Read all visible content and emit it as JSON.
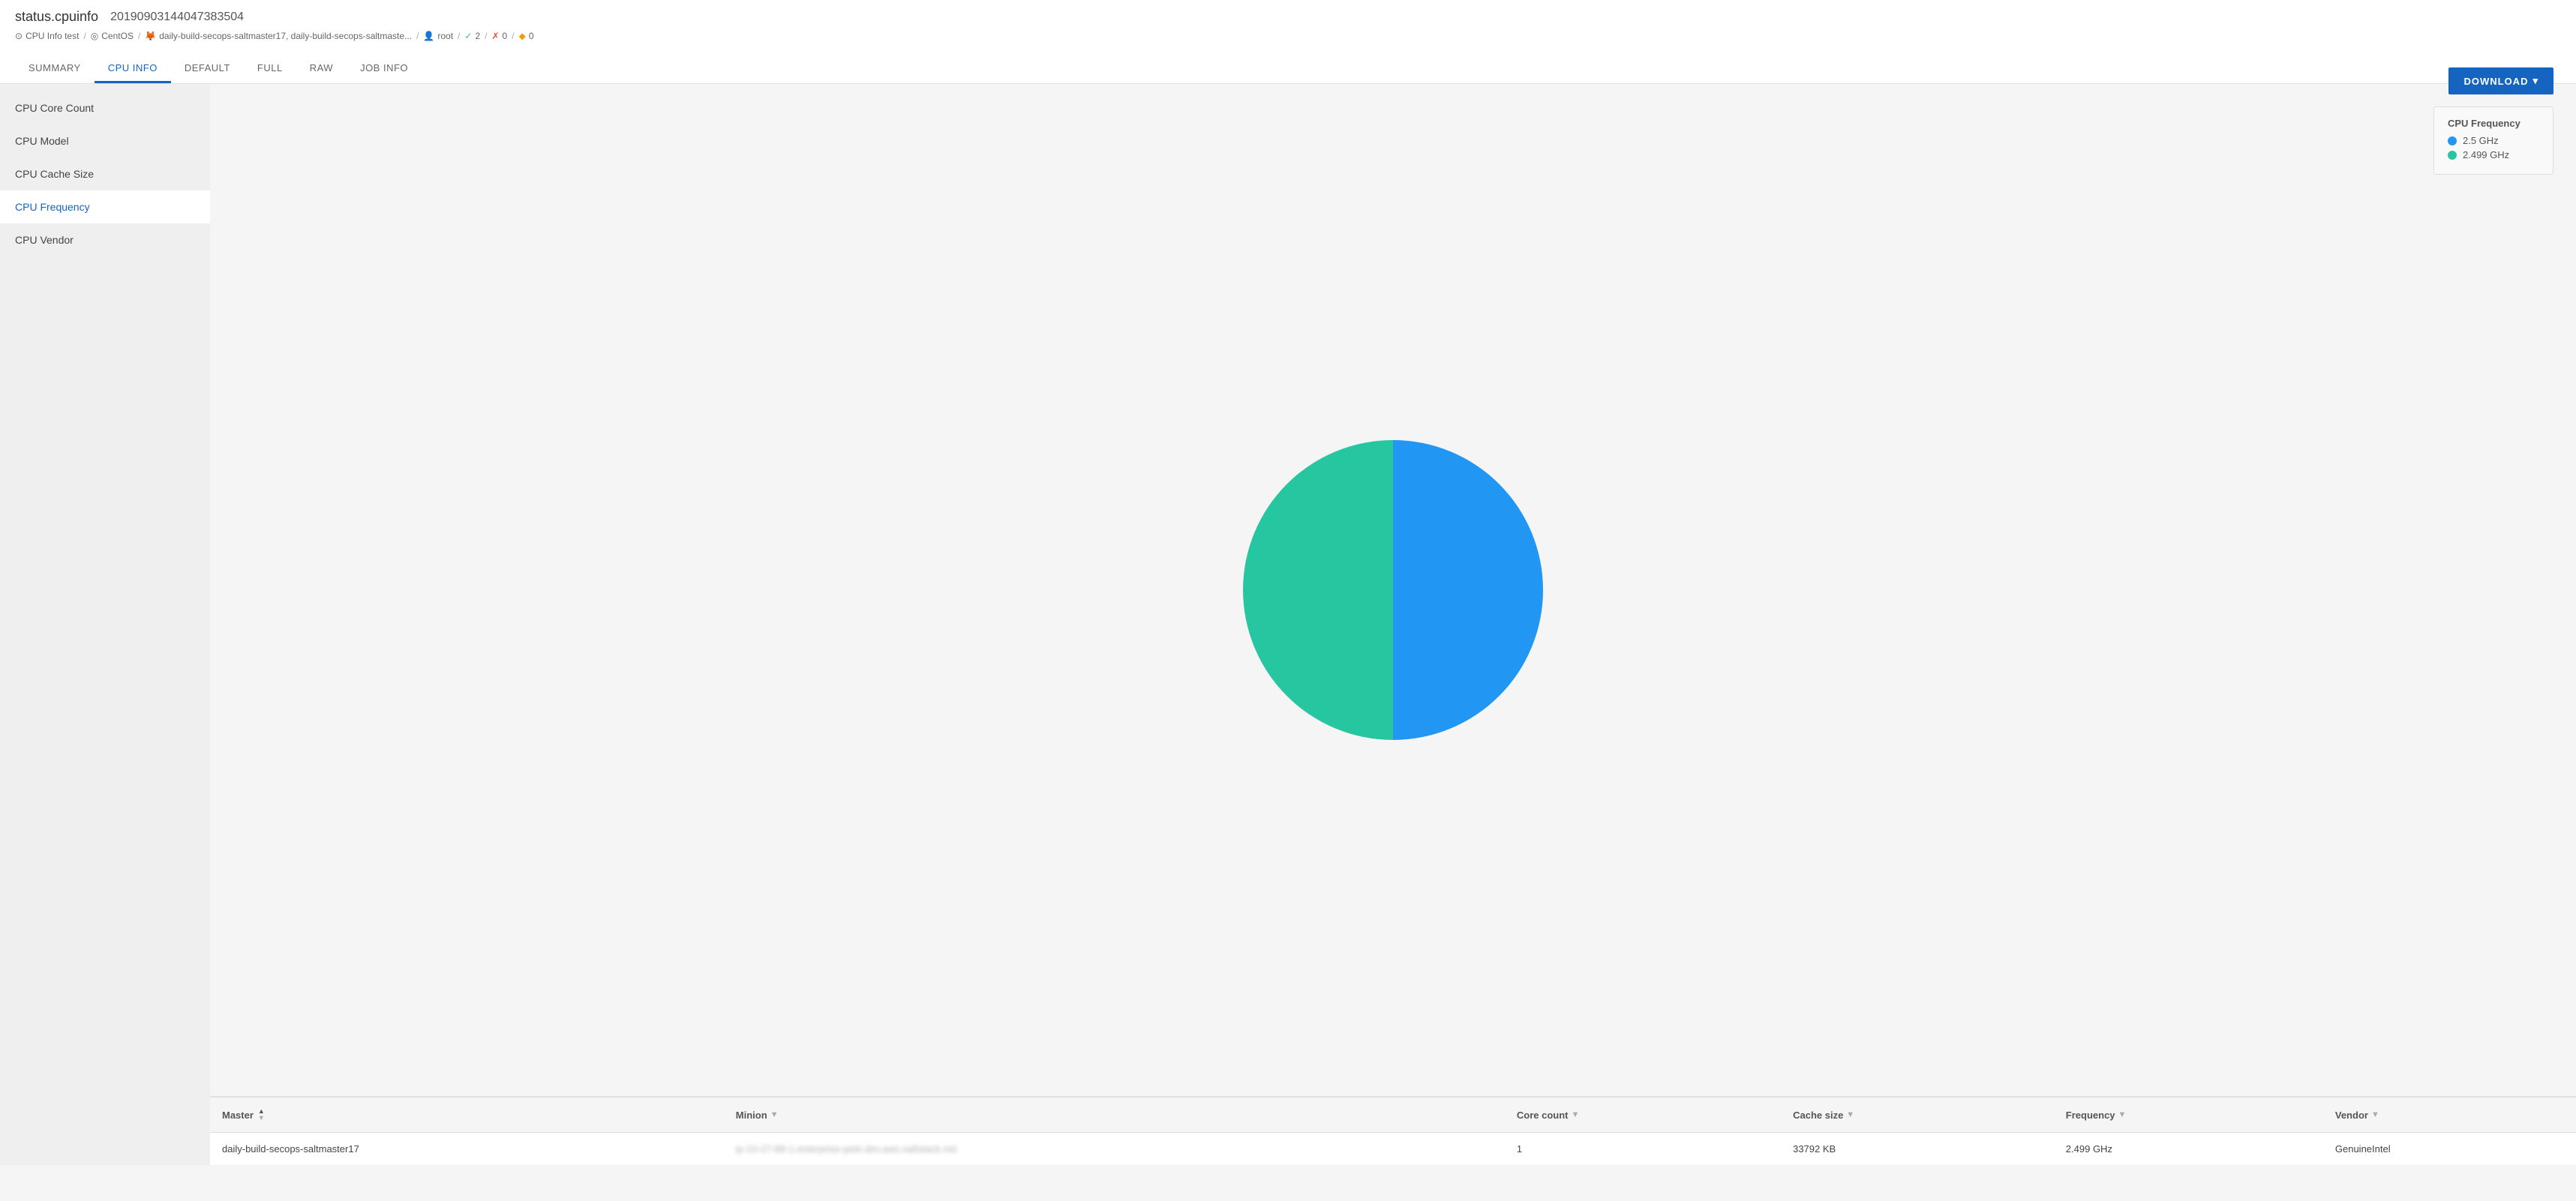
{
  "page": {
    "title": "status.cpuinfo",
    "job_id": "20190903144047383504"
  },
  "breadcrumb": {
    "items": [
      {
        "icon": "⊙",
        "label": "CPU Info test"
      },
      {
        "icon": "◎",
        "label": "CentOS"
      },
      {
        "icon": "🦊",
        "label": "daily-build-secops-saltmaster17, daily-build-secops-saltmaste..."
      },
      {
        "icon": "👤",
        "label": "root"
      },
      {
        "check": "✓",
        "count": "2"
      },
      {
        "cross": "✗",
        "count": "0"
      },
      {
        "diamond": "◆",
        "count": "0"
      }
    ]
  },
  "tabs": [
    {
      "id": "summary",
      "label": "SUMMARY",
      "active": false
    },
    {
      "id": "cpu-info",
      "label": "CPU INFO",
      "active": true
    },
    {
      "id": "default",
      "label": "DEFAULT",
      "active": false
    },
    {
      "id": "full",
      "label": "FULL",
      "active": false
    },
    {
      "id": "raw",
      "label": "RAW",
      "active": false
    },
    {
      "id": "job-info",
      "label": "JOB INFO",
      "active": false
    }
  ],
  "download_button": "DOWNLOAD",
  "sidebar": {
    "items": [
      {
        "id": "cpu-core-count",
        "label": "CPU Core Count",
        "active": false
      },
      {
        "id": "cpu-model",
        "label": "CPU Model",
        "active": false
      },
      {
        "id": "cpu-cache-size",
        "label": "CPU Cache Size",
        "active": false
      },
      {
        "id": "cpu-frequency",
        "label": "CPU Frequency",
        "active": true
      },
      {
        "id": "cpu-vendor",
        "label": "CPU Vendor",
        "active": false
      }
    ]
  },
  "chart": {
    "title": "CPU Frequency",
    "legend": [
      {
        "label": "2.5 GHz",
        "color": "#2196f3"
      },
      {
        "label": "2.499 GHz",
        "color": "#26c6a0"
      }
    ],
    "segments": [
      {
        "value": 50,
        "color": "#2196f3"
      },
      {
        "value": 50,
        "color": "#26c6a0"
      }
    ]
  },
  "table": {
    "columns": [
      {
        "id": "master",
        "label": "Master",
        "sortable": true,
        "filterable": false
      },
      {
        "id": "minion",
        "label": "Minion",
        "sortable": false,
        "filterable": true
      },
      {
        "id": "core-count",
        "label": "Core count",
        "sortable": false,
        "filterable": true
      },
      {
        "id": "cache-size",
        "label": "Cache size",
        "sortable": false,
        "filterable": true
      },
      {
        "id": "frequency",
        "label": "Frequency",
        "sortable": false,
        "filterable": true
      },
      {
        "id": "vendor",
        "label": "Vendor",
        "sortable": false,
        "filterable": true
      }
    ],
    "rows": [
      {
        "master": "daily-build-secops-saltmaster17",
        "minion": "ip-10-27-88-1.enterprise-pele.dev.aws.saltstack.net",
        "minion_blurred": true,
        "core_count": "1",
        "cache_size": "33792 KB",
        "frequency": "2.499 GHz",
        "vendor": "GenuineIntel"
      }
    ]
  }
}
